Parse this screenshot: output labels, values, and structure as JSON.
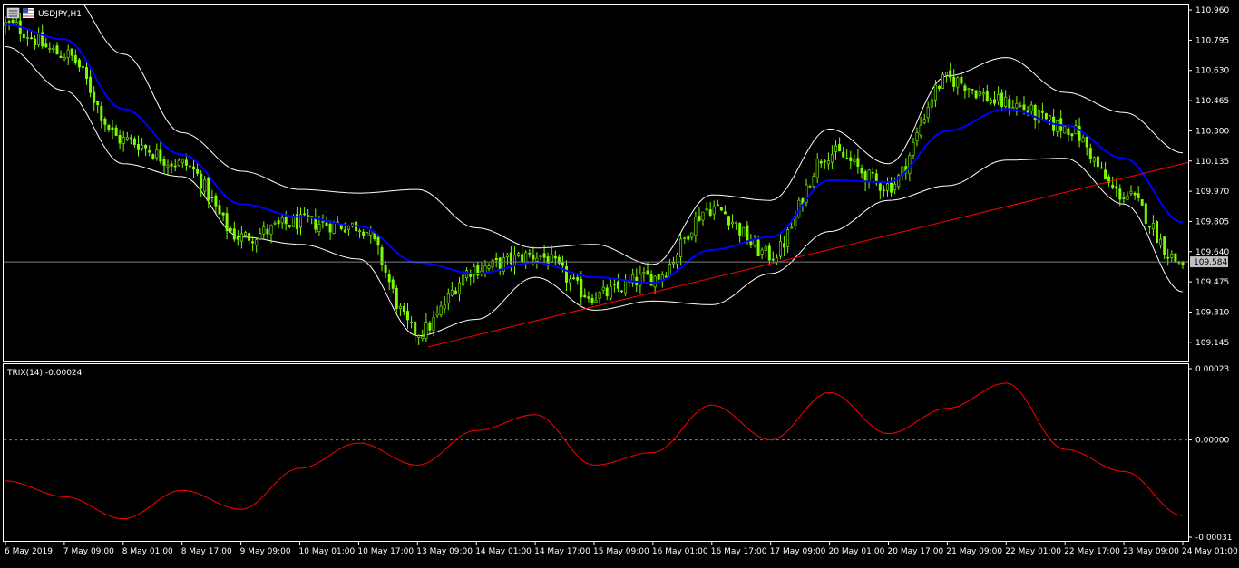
{
  "window": {
    "title": "USDJPY,H1",
    "icon_name": "chart-window-icon"
  },
  "colors": {
    "background": "#000000",
    "candle_bull": "#7CFC00",
    "candle_bear": "#7CFC00",
    "bands": "#FFFFFF",
    "middle_line": "#0000FF",
    "trendline": "#FF0000",
    "trix": "#FF0000",
    "price_line": "#808080",
    "current_price_tag": "#C0C0C0",
    "axis_text": "#FFFFFF"
  },
  "chart_data": [
    {
      "type": "candlestick",
      "title": "USDJPY,H1",
      "symbol": "USDJPY",
      "timeframe": "H1",
      "ylim": [
        109.04,
        110.99
      ],
      "y_ticks": [
        "110.960",
        "110.795",
        "110.630",
        "110.465",
        "110.300",
        "110.135",
        "109.970",
        "109.805",
        "109.640",
        "109.475",
        "109.310",
        "109.145"
      ],
      "current_price": "109.584",
      "x_ticks": [
        "6 May 2019",
        "7 May 09:00",
        "8 May 01:00",
        "8 May 17:00",
        "9 May 09:00",
        "10 May 01:00",
        "10 May 17:00",
        "13 May 09:00",
        "14 May 01:00",
        "14 May 17:00",
        "15 May 09:00",
        "16 May 01:00",
        "16 May 17:00",
        "17 May 09:00",
        "20 May 01:00",
        "20 May 17:00",
        "21 May 09:00",
        "22 May 01:00",
        "22 May 17:00",
        "23 May 09:00",
        "24 May 01:00"
      ],
      "overlays": [
        "Bollinger Bands",
        "Moving Average",
        "Trendline"
      ],
      "close_path": [
        [
          "6 May 2019",
          110.88
        ],
        [
          "7 May 09:00",
          110.72
        ],
        [
          "8 May 01:00",
          110.25
        ],
        [
          "8 May 17:00",
          110.12
        ],
        [
          "9 May 09:00",
          109.72
        ],
        [
          "10 May 01:00",
          109.8
        ],
        [
          "10 May 17:00",
          109.78
        ],
        [
          "13 May 09:00",
          109.2
        ],
        [
          "14 May 01:00",
          109.55
        ],
        [
          "14 May 17:00",
          109.62
        ],
        [
          "15 May 09:00",
          109.4
        ],
        [
          "16 May 01:00",
          109.5
        ],
        [
          "16 May 17:00",
          109.88
        ],
        [
          "17 May 09:00",
          109.62
        ],
        [
          "20 May 01:00",
          110.18
        ],
        [
          "20 May 17:00",
          110.0
        ],
        [
          "21 May 09:00",
          110.58
        ],
        [
          "22 May 01:00",
          110.45
        ],
        [
          "22 May 17:00",
          110.32
        ],
        [
          "23 May 09:00",
          109.95
        ],
        [
          "24 May 01:00",
          109.58
        ]
      ],
      "ma_path": [
        [
          "6 May 2019",
          110.88
        ],
        [
          "7 May 09:00",
          110.8
        ],
        [
          "8 May 01:00",
          110.42
        ],
        [
          "8 May 17:00",
          110.17
        ],
        [
          "9 May 09:00",
          109.9
        ],
        [
          "10 May 01:00",
          109.83
        ],
        [
          "10 May 17:00",
          109.78
        ],
        [
          "13 May 09:00",
          109.58
        ],
        [
          "14 May 01:00",
          109.52
        ],
        [
          "14 May 17:00",
          109.58
        ],
        [
          "15 May 09:00",
          109.5
        ],
        [
          "16 May 01:00",
          109.47
        ],
        [
          "16 May 17:00",
          109.65
        ],
        [
          "17 May 09:00",
          109.72
        ],
        [
          "20 May 01:00",
          110.03
        ],
        [
          "20 May 17:00",
          110.02
        ],
        [
          "21 May 09:00",
          110.3
        ],
        [
          "22 May 01:00",
          110.42
        ],
        [
          "22 May 17:00",
          110.33
        ],
        [
          "23 May 09:00",
          110.15
        ],
        [
          "24 May 01:00",
          109.8
        ]
      ],
      "band_width": [
        [
          "6 May 2019",
          0.12
        ],
        [
          "7 May 09:00",
          0.28
        ],
        [
          "8 May 01:00",
          0.3
        ],
        [
          "8 May 17:00",
          0.12
        ],
        [
          "9 May 09:00",
          0.18
        ],
        [
          "10 May 01:00",
          0.15
        ],
        [
          "10 May 17:00",
          0.18
        ],
        [
          "13 May 09:00",
          0.4
        ],
        [
          "14 May 01:00",
          0.25
        ],
        [
          "14 May 17:00",
          0.08
        ],
        [
          "15 May 09:00",
          0.18
        ],
        [
          "16 May 01:00",
          0.1
        ],
        [
          "16 May 17:00",
          0.3
        ],
        [
          "17 May 09:00",
          0.2
        ],
        [
          "20 May 01:00",
          0.28
        ],
        [
          "20 May 17:00",
          0.1
        ],
        [
          "21 May 09:00",
          0.3
        ],
        [
          "22 May 01:00",
          0.28
        ],
        [
          "22 May 17:00",
          0.18
        ],
        [
          "23 May 09:00",
          0.25
        ],
        [
          "24 May 01:00",
          0.38
        ]
      ],
      "trendline": [
        [
          "13 May 09:00",
          109.12
        ],
        [
          "24 May 01:00",
          110.12
        ]
      ]
    },
    {
      "type": "line",
      "title": "TRIX(14) -0.00024",
      "ylim": [
        -0.00032,
        0.00024
      ],
      "y_ticks": [
        "0.00023",
        "0.00000",
        "-0.00031"
      ],
      "zero_line": 0.0,
      "series": [
        {
          "name": "TRIX(14)",
          "values": [
            [
              "6 May 2019",
              -0.00013
            ],
            [
              "7 May 09:00",
              -0.00018
            ],
            [
              "8 May 01:00",
              -0.00025
            ],
            [
              "8 May 17:00",
              -0.00016
            ],
            [
              "9 May 09:00",
              -0.00022
            ],
            [
              "10 May 01:00",
              -9e-05
            ],
            [
              "10 May 17:00",
              -1e-05
            ],
            [
              "13 May 09:00",
              -8e-05
            ],
            [
              "14 May 01:00",
              3e-05
            ],
            [
              "14 May 17:00",
              8e-05
            ],
            [
              "15 May 09:00",
              -8e-05
            ],
            [
              "16 May 01:00",
              -4e-05
            ],
            [
              "16 May 17:00",
              0.00011
            ],
            [
              "17 May 09:00",
              0.0
            ],
            [
              "20 May 01:00",
              0.00015
            ],
            [
              "20 May 17:00",
              2e-05
            ],
            [
              "21 May 09:00",
              0.0001
            ],
            [
              "22 May 01:00",
              0.00018
            ],
            [
              "22 May 17:00",
              -3e-05
            ],
            [
              "23 May 09:00",
              -0.0001
            ],
            [
              "24 May 01:00",
              -0.00024
            ]
          ]
        }
      ]
    }
  ]
}
